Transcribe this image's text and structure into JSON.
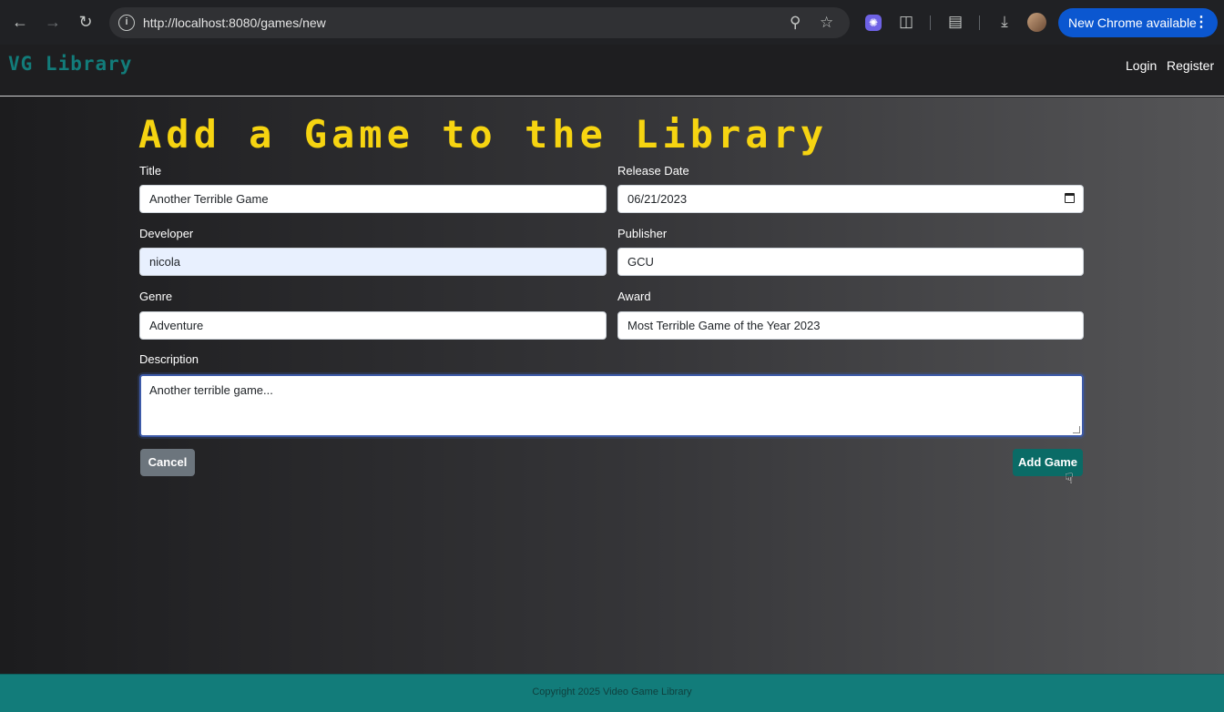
{
  "browser": {
    "url": "http://localhost:8080/games/new",
    "update_label": "New Chrome available"
  },
  "site": {
    "brand": "VG Library",
    "nav": {
      "login": "Login",
      "register": "Register"
    }
  },
  "form": {
    "heading": "Add a Game to the Library",
    "fields": {
      "title": {
        "label": "Title",
        "value": "Another Terrible Game"
      },
      "release_date": {
        "label": "Release Date",
        "value": "06/21/2023"
      },
      "developer": {
        "label": "Developer",
        "value": "nicola"
      },
      "publisher": {
        "label": "Publisher",
        "value": "GCU"
      },
      "genre": {
        "label": "Genre",
        "value": "Adventure"
      },
      "award": {
        "label": "Award",
        "value": "Most Terrible Game of the Year 2023"
      },
      "description": {
        "label": "Description",
        "value": "Another terrible game..."
      }
    },
    "buttons": {
      "cancel": "Cancel",
      "submit": "Add Game"
    }
  },
  "footer": {
    "text": "Copyright 2025 Video Game Library"
  },
  "colors": {
    "brand": "#127c7a",
    "heading": "#f6d411",
    "submit": "#0a6b66",
    "cancel": "#6c757d"
  }
}
